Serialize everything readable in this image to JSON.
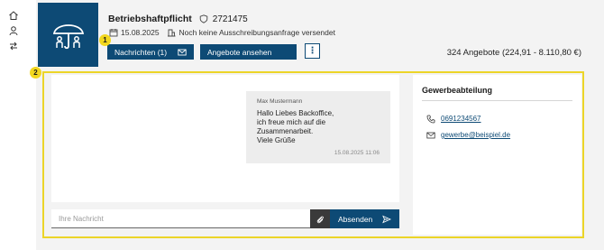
{
  "rail": {
    "items": [
      "home-icon",
      "user-icon",
      "swap-icon"
    ]
  },
  "header": {
    "title": "Betriebshaftpflicht",
    "policy_number": "2721475",
    "date": "15.08.2025",
    "status": "Noch keine Ausschreibungsanfrage versendet",
    "messages_button": "Nachrichten (1)",
    "offers_button": "Angebote ansehen",
    "more_button": "⋮",
    "offers_summary": "324 Angebote (224,91 - 8.110,80 €)"
  },
  "badges": {
    "one": "1",
    "two": "2"
  },
  "chat": {
    "message": {
      "sender": "Max Mustermann",
      "lines": [
        "Hallo Liebes Backoffice,",
        "ich freue mich auf die Zusammenarbeit.",
        "Viele Grüße"
      ],
      "timestamp": "15.08.2025 11:06"
    },
    "input_placeholder": "Ihre Nachricht",
    "send_label": "Absenden"
  },
  "sidebar": {
    "title": "Gewerbeabteilung",
    "phone": "0691234567",
    "email": "gewerbe@beispiel.de"
  },
  "colors": {
    "brand": "#0d4a75",
    "highlight": "#ecd528",
    "background": "#f3f3f3"
  }
}
